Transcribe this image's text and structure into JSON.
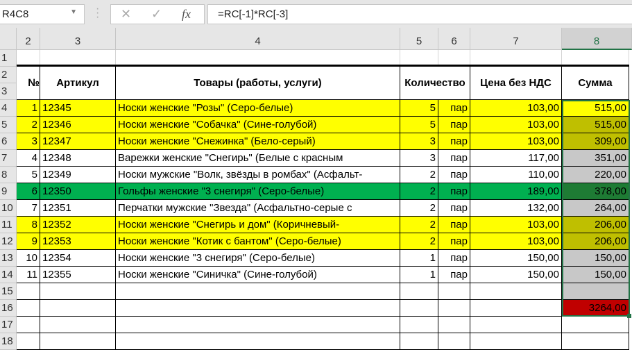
{
  "name_box": "R4C8",
  "formula": "=RC[-1]*RC[-3]",
  "fx_label": "fx",
  "columns": [
    "2",
    "3",
    "4",
    "5",
    "6",
    "7",
    "8"
  ],
  "rows": [
    "1",
    "2",
    "3",
    "4",
    "5",
    "6",
    "7",
    "8",
    "9",
    "10",
    "11",
    "12",
    "13",
    "14",
    "15",
    "16",
    "17",
    "18"
  ],
  "headers": {
    "num": "№",
    "article": "Артикул",
    "goods": "Товары (работы, услуги)",
    "qty": "Количество",
    "price": "Цена без НДС",
    "sum": "Сумма"
  },
  "colors": {
    "yellow": "#ffff00",
    "green": "#00b050",
    "olive": "#bfbf00",
    "gray": "#c8c8c8",
    "darkgreen": "#1e7b34",
    "red": "#c00000"
  },
  "items": [
    {
      "n": "1",
      "art": "12345",
      "name": "Носки женские \"Розы\" (Серо-белые)",
      "qty": "5",
      "unit": "пар",
      "price": "103,00",
      "sum": "515,00",
      "bg": "yellow",
      "sbg": "yellow"
    },
    {
      "n": "2",
      "art": "12346",
      "name": "Носки женские \"Собачка\" (Сине-голубой)",
      "qty": "5",
      "unit": "пар",
      "price": "103,00",
      "sum": "515,00",
      "bg": "yellow",
      "sbg": "olive"
    },
    {
      "n": "3",
      "art": "12347",
      "name": "Носки женские \"Снежинка\" (Бело-серый)",
      "qty": "3",
      "unit": "пар",
      "price": "103,00",
      "sum": "309,00",
      "bg": "yellow",
      "sbg": "olive"
    },
    {
      "n": "4",
      "art": "12348",
      "name": "Варежки женские \"Снегирь\" (Белые с красным",
      "qty": "3",
      "unit": "пар",
      "price": "117,00",
      "sum": "351,00",
      "bg": "",
      "sbg": "gray"
    },
    {
      "n": "5",
      "art": "12349",
      "name": "Носки мужские \"Волк, звёзды в ромбах\" (Асфальт-",
      "qty": "2",
      "unit": "пар",
      "price": "110,00",
      "sum": "220,00",
      "bg": "",
      "sbg": "gray"
    },
    {
      "n": "6",
      "art": "12350",
      "name": "Гольфы женские \"3 снегиря\" (Серо-белые)",
      "qty": "2",
      "unit": "пар",
      "price": "189,00",
      "sum": "378,00",
      "bg": "green",
      "sbg": "darkgreen"
    },
    {
      "n": "7",
      "art": "12351",
      "name": "Перчатки мужские \"Звезда\" (Асфальтно-серые с",
      "qty": "2",
      "unit": "пар",
      "price": "132,00",
      "sum": "264,00",
      "bg": "",
      "sbg": "gray"
    },
    {
      "n": "8",
      "art": "12352",
      "name": "Носки женские \"Снегирь и дом\" (Коричневый-",
      "qty": "2",
      "unit": "пар",
      "price": "103,00",
      "sum": "206,00",
      "bg": "yellow",
      "sbg": "olive"
    },
    {
      "n": "9",
      "art": "12353",
      "name": "Носки женские \"Котик с бантом\" (Серо-белые)",
      "qty": "2",
      "unit": "пар",
      "price": "103,00",
      "sum": "206,00",
      "bg": "yellow",
      "sbg": "olive"
    },
    {
      "n": "10",
      "art": "12354",
      "name": "Носки женские \"3 снегиря\" (Серо-белые)",
      "qty": "1",
      "unit": "пар",
      "price": "150,00",
      "sum": "150,00",
      "bg": "",
      "sbg": "gray"
    },
    {
      "n": "11",
      "art": "12355",
      "name": "Носки женские \"Синичка\" (Сине-голубой)",
      "qty": "1",
      "unit": "пар",
      "price": "150,00",
      "sum": "150,00",
      "bg": "",
      "sbg": "gray"
    }
  ],
  "total": "3264,00"
}
